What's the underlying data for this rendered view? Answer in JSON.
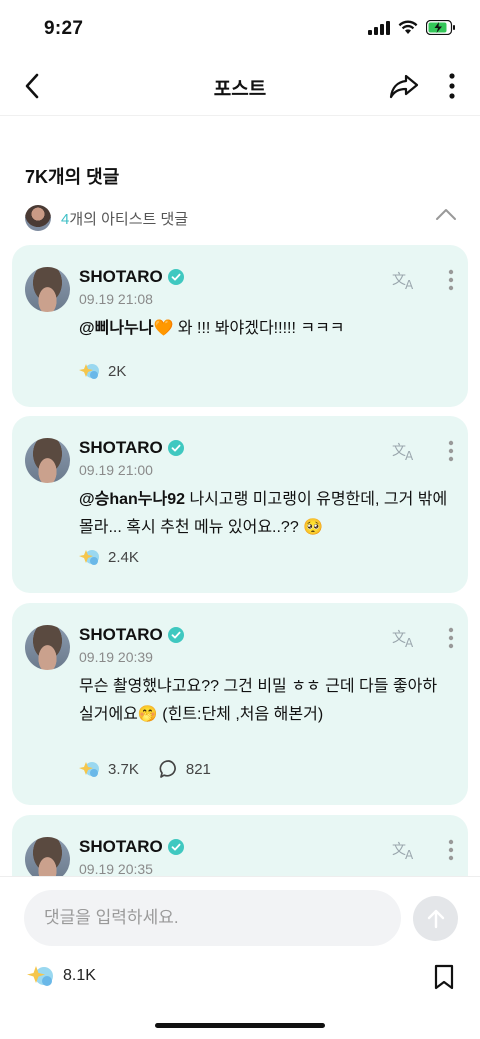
{
  "status": {
    "time": "9:27"
  },
  "nav": {
    "title": "포스트"
  },
  "comments": {
    "count_label": "7K개의 댓글",
    "artist_count": "4",
    "artist_label": "개의 아티스트 댓글"
  },
  "cards": [
    {
      "name": "SHOTARO",
      "date": "09.19 21:08",
      "mention": "@삐나누나",
      "emoji1": "🧡",
      "text": " 와 !!! 봐야겠다!!!!! ㅋㅋㅋ",
      "likes": "2K"
    },
    {
      "name": "SHOTARO",
      "date": "09.19 21:00",
      "mention": "@승han누나92",
      "text": " 나시고랭 미고랭이 유명한데, 그거 밖에 몰라... 혹시 추천 메뉴 있어요..?? 🥺",
      "likes": "2.4K"
    },
    {
      "name": "SHOTARO",
      "date": "09.19 20:39",
      "text": "무슨 촬영했냐고요?? 그건 비밀 ㅎㅎ 근데 다들 좋아하실거에요🤭 (힌트:단체 ,처음 해본거)",
      "likes": "3.7K",
      "replies": "821"
    },
    {
      "name": "SHOTARO",
      "date": "09.19 20:35"
    }
  ],
  "input": {
    "placeholder": "댓글을 입력하세요."
  },
  "bottom": {
    "likes": "8.1K"
  },
  "colors": {
    "card_bg": "#e8f7f4",
    "accent": "#3fbfc6",
    "verified": "#3fc8c0"
  }
}
